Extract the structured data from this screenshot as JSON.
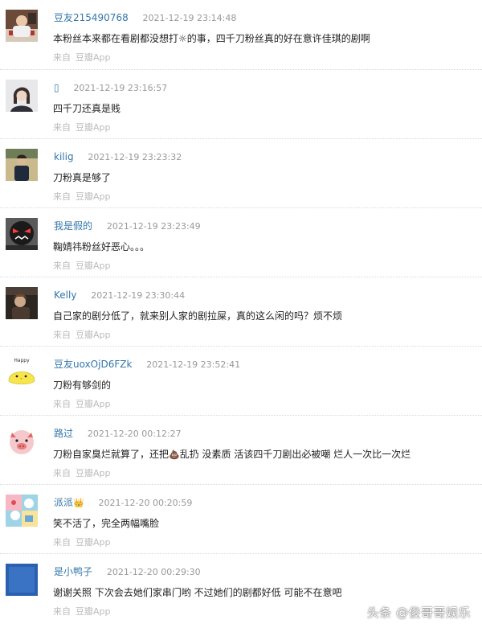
{
  "comments": [
    {
      "username": "豆友215490768",
      "time": "2021-12-19 23:14:48",
      "text": "本粉丝本来都在看剧都没想打☼的事，四千刀粉丝真的好在意许佳琪的剧啊",
      "source_prefix": "来自",
      "source_app": "豆瓣App",
      "avatar_icon": "person-photo-avatar"
    },
    {
      "username": "▯",
      "time": "2021-12-19 23:16:57",
      "text": "四千刀还真是贱",
      "source_prefix": "来自",
      "source_app": "豆瓣App",
      "avatar_icon": "woman-photo-avatar"
    },
    {
      "username": "kilig",
      "time": "2021-12-19 23:23:32",
      "text": "刀粉真是够了",
      "source_prefix": "来自",
      "source_app": "豆瓣App",
      "avatar_icon": "person-photo-avatar"
    },
    {
      "username": "我是假的",
      "time": "2021-12-19 23:23:49",
      "text": "鞠婧祎粉丝好恶心。。。",
      "source_prefix": "来自",
      "source_app": "豆瓣App",
      "avatar_icon": "cartoon-angry-avatar"
    },
    {
      "username": "Kelly",
      "time": "2021-12-19 23:30:44",
      "text": "自己家的剧分低了，就来别人家的剧拉屎，真的这么闲的吗？烦不烦",
      "source_prefix": "来自",
      "source_app": "豆瓣App",
      "avatar_icon": "person-photo-avatar"
    },
    {
      "username": "豆友uoxOjD6FZk",
      "time": "2021-12-19 23:52:41",
      "text": "刀粉有够剑的",
      "source_prefix": "来自",
      "source_app": "豆瓣App",
      "avatar_icon": "yellow-chick-avatar",
      "avatar_label": "Happy"
    },
    {
      "username": "路过",
      "time": "2021-12-20 00:12:27",
      "text_before": "刀粉自家臭烂就算了，还把",
      "text_emoji": "💩",
      "text_after": "乱扔 没素质 活该四千刀剧出必被嘲 烂人一次比一次烂",
      "source_prefix": "来自",
      "source_app": "豆瓣App",
      "avatar_icon": "pink-pig-avatar"
    },
    {
      "username": "派派",
      "username_tag": "👑",
      "time": "2021-12-20 00:20:59",
      "text": "笑不活了，完全两幅嘴脸",
      "source_prefix": "来自",
      "source_app": "豆瓣App",
      "avatar_icon": "cartoon-collage-avatar"
    },
    {
      "username": "是小鸭子",
      "time": "2021-12-20 00:29:30",
      "text": "谢谢关照 下次会去她们家串门哟 不过她们的剧都好低 可能不在意吧",
      "source_prefix": "来自",
      "source_app": "豆瓣App",
      "avatar_icon": "blue-square-avatar"
    }
  ],
  "watermark": "头条 @俊哥哥娱乐",
  "colors": {
    "username": "#3377aa",
    "time": "#999999",
    "source": "#bbbbbb",
    "text": "#222222"
  }
}
